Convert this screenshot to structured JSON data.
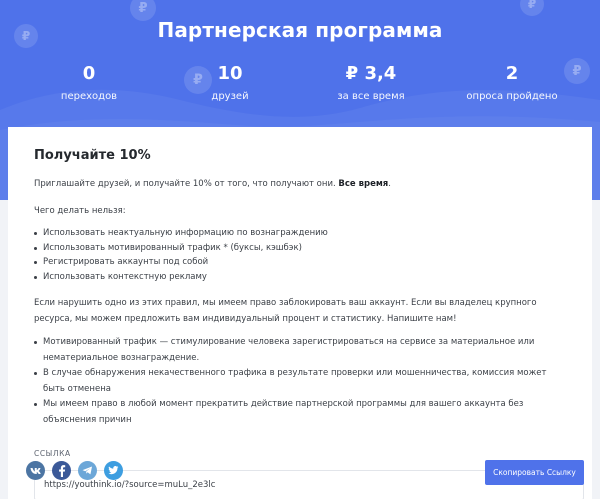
{
  "header": {
    "title": "Партнерская программа",
    "bg_color": "#4f72ea",
    "coin_icon": "ruble-coin-icon"
  },
  "stats": [
    {
      "value": "0",
      "label": "переходов"
    },
    {
      "value": "10",
      "label": "друзей"
    },
    {
      "value": "₽ 3,4",
      "label": "за все время"
    },
    {
      "value": "2",
      "label": "опроса пройдено"
    }
  ],
  "card": {
    "title": "Получайте 10%",
    "intro_text": "Приглашайте друзей, и получайте 10% от того, что получают они. ",
    "intro_bold": "Все время",
    "intro_tail": ".",
    "forbid_heading": "Чего делать нельзя:",
    "rules": [
      "Использовать неактуальную информацию по вознаграждению",
      "Использовать мотивированный трафик * (буксы, кэшбэк)",
      "Регистрировать аккаунты под собой",
      "Использовать контекстную рекламу"
    ],
    "warning": "Если нарушить одно из этих правил, мы имеем право заблокировать ваш аккаунт. Если вы владелец крупного ресурса, мы можем предложить вам индивидуальный процент и статистику. Напишите нам!",
    "notes": [
      "Мотивированный трафик — стимулирование человека зарегистрироваться на сервисе за материальное или нематериальное вознаграждение.",
      "В случае обнаружения некачественного трафика в результате проверки или мошенничества, комиссия может быть отменена",
      "Мы имеем право в любой момент прекратить действие партнерской программы для вашего аккаунта без объяснения причин"
    ],
    "link_label": "Ссылка",
    "link_value": "https://youthink.io/?source=muLu_2e3lc",
    "copy_button": "Скопировать Ссылку"
  },
  "social": [
    {
      "icon": "vk-icon",
      "glyph": "vk",
      "color": "#4c75a3"
    },
    {
      "icon": "facebook-icon",
      "glyph": "f",
      "color": "#3b5998"
    },
    {
      "icon": "telegram-icon",
      "glyph": "➤",
      "color": "#6ca7d8"
    },
    {
      "icon": "twitter-icon",
      "glyph": "🐦",
      "color": "#3d9ee0"
    }
  ]
}
